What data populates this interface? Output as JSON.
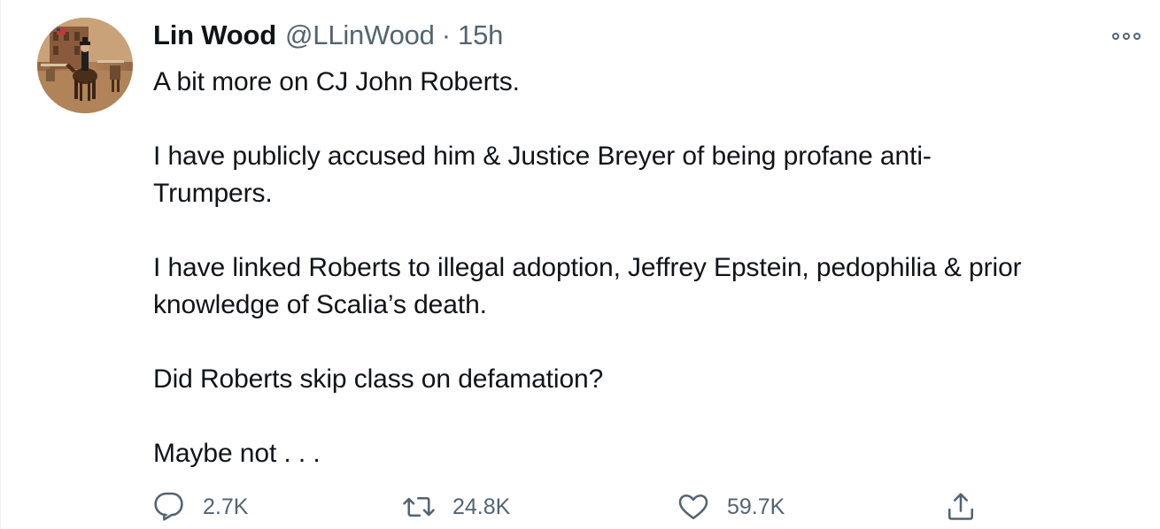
{
  "tweet": {
    "author": {
      "name": "Lin Wood",
      "handle": "@LLinWood",
      "separator": "·",
      "time": "15h"
    },
    "text": {
      "p1": "A bit more on CJ John Roberts.",
      "p2_line1": "I have publicly accused him & Justice Breyer of being profane anti-",
      "p2_line2": "Trumpers.",
      "p3_line1": "I have linked Roberts to illegal adoption, Jeffrey Epstein, pedophilia & prior",
      "p3_line2": "knowledge of Scalia’s death.",
      "p4": "Did Roberts skip class on defamation?",
      "p5": "Maybe not . . ."
    },
    "stats": {
      "replies": "2.7K",
      "retweets": "24.8K",
      "likes": "59.7K"
    },
    "icons": {
      "reply": "reply-icon",
      "retweet": "retweet-icon",
      "like": "heart-icon",
      "share": "share-icon",
      "more": "more-options-icon"
    },
    "colors": {
      "text_primary": "#0f1419",
      "text_secondary": "#536471",
      "background": "#ffffff"
    }
  }
}
